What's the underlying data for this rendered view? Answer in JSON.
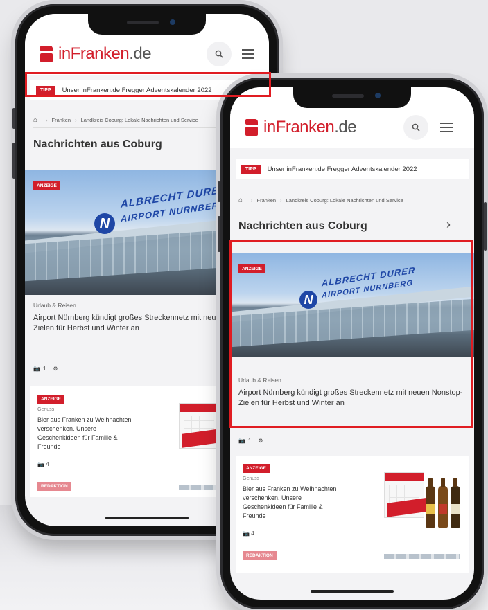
{
  "brand": {
    "name": "inFranken",
    "tld": ".de",
    "accent": "#d21e2b"
  },
  "tip": {
    "badge": "TIPP",
    "text": "Unser inFranken.de Fregger Adventskalender 2022"
  },
  "breadcrumb": {
    "items": [
      "Franken",
      "Landkreis Coburg: Lokale Nachrichten und Service"
    ]
  },
  "section": {
    "title": "Nachrichten aus Coburg"
  },
  "hero": {
    "badge": "ANZEIGE",
    "sign_line1": "ALBRECHT DURER",
    "sign_line2": "AIRPORT NURNBERG",
    "sign_logo": "N",
    "kicker": "Urlaub & Reisen",
    "headline": "Airport Nürnberg kündigt großes Streckennetz mit neuen Nonstop-Zielen für Herbst und Winter an",
    "photo_count": "1"
  },
  "promo": {
    "badge": "ANZEIGE",
    "kicker": "Genuss",
    "title": "Bier aus Franken zu Weihnachten verschenken. Unsere Geschenkideen für Familie & Freunde",
    "photo_count": "4",
    "sub_badge": "REDAKTION"
  },
  "icons": {
    "search": "search-icon",
    "menu": "hamburger-menu-icon",
    "home": "home-icon",
    "camera": "camera-icon",
    "chevron": "chevron-right-icon"
  },
  "highlight_color": "#e01c22"
}
